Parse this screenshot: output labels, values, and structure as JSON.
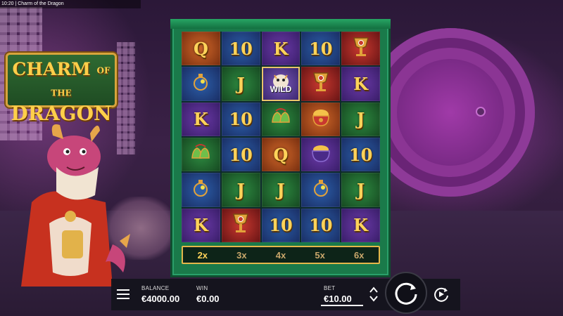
{
  "window": {
    "title": "10:20 | Charm of the Dragon"
  },
  "logo": {
    "line1": "CHARM",
    "line1_small": "OF THE",
    "line2": "DRAGON"
  },
  "reels": {
    "rows": [
      [
        {
          "sym": "Q",
          "bg": "orange"
        },
        {
          "sym": "10",
          "bg": "blue"
        },
        {
          "sym": "K",
          "bg": "purple"
        },
        {
          "sym": "10",
          "bg": "blue"
        },
        {
          "sym": "goblet",
          "bg": "red"
        }
      ],
      [
        {
          "sym": "lantern",
          "bg": "blue"
        },
        {
          "sym": "J",
          "bg": "green"
        },
        {
          "sym": "WILD",
          "bg": "wild"
        },
        {
          "sym": "goblet",
          "bg": "red"
        },
        {
          "sym": "K",
          "bg": "purple"
        }
      ],
      [
        {
          "sym": "K",
          "bg": "purple"
        },
        {
          "sym": "10",
          "bg": "blue"
        },
        {
          "sym": "bells",
          "bg": "green"
        },
        {
          "sym": "coin-pot",
          "bg": "orange"
        },
        {
          "sym": "J",
          "bg": "green"
        }
      ],
      [
        {
          "sym": "bells",
          "bg": "green"
        },
        {
          "sym": "10",
          "bg": "blue"
        },
        {
          "sym": "Q",
          "bg": "orange"
        },
        {
          "sym": "cauldron",
          "bg": "purple"
        },
        {
          "sym": "10",
          "bg": "blue"
        }
      ],
      [
        {
          "sym": "lantern",
          "bg": "blue"
        },
        {
          "sym": "J",
          "bg": "green"
        },
        {
          "sym": "J",
          "bg": "green"
        },
        {
          "sym": "lantern",
          "bg": "blue"
        },
        {
          "sym": "J",
          "bg": "green"
        }
      ],
      [
        {
          "sym": "K",
          "bg": "purple"
        },
        {
          "sym": "goblet",
          "bg": "red"
        },
        {
          "sym": "10",
          "bg": "blue"
        },
        {
          "sym": "10",
          "bg": "blue"
        },
        {
          "sym": "K",
          "bg": "purple"
        }
      ]
    ],
    "wild_label": "WILD"
  },
  "multipliers": [
    "2x",
    "3x",
    "4x",
    "5x",
    "6x"
  ],
  "active_multiplier": "2x",
  "hud": {
    "balance_label": "BALANCE",
    "balance_value": "€4000.00",
    "win_label": "WIN",
    "win_value": "€0.00",
    "bet_label": "BET",
    "bet_value": "€10.00"
  },
  "icons": {
    "menu": "hamburger-menu-icon",
    "spin": "spin-arrow-icon",
    "autoplay": "autoplay-icon",
    "bet_up": "chevron-up-icon",
    "bet_down": "chevron-down-icon"
  }
}
